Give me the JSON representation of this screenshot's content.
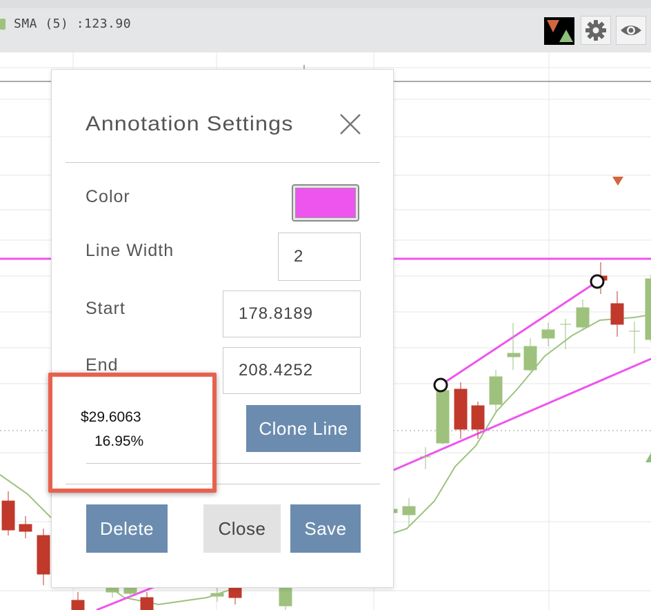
{
  "toolbar": {
    "sma_label": "SMA (5) :123.90",
    "sma_color": "#9ec27e",
    "icons": [
      "markers-icon",
      "gear-icon",
      "eye-icon"
    ]
  },
  "chart": {
    "annotation_color": "#ee55ee",
    "up_color": "#9ec27e",
    "down_color": "#c0392b"
  },
  "dialog": {
    "title": "Annotation Settings",
    "color_label": "Color",
    "color_value": "#ee55ee",
    "line_width_label": "Line Width",
    "line_width_value": "2",
    "start_label": "Start",
    "start_value": "178.8189",
    "end_label": "End",
    "end_value": "208.4252",
    "change_value": "$29.6063",
    "change_percent": "16.95%",
    "clone_label": "Clone Line",
    "delete_label": "Delete",
    "close_label": "Close",
    "save_label": "Save"
  },
  "highlight_color": "#e8614e"
}
